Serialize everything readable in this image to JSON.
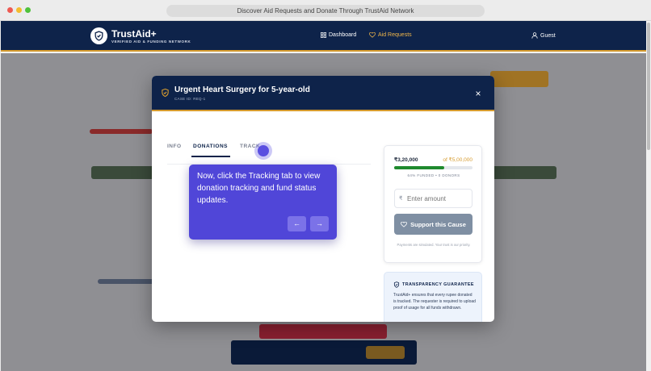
{
  "browser": {
    "url_title": "Discover Aid Requests and Donate Through TrustAid Network"
  },
  "navbar": {
    "brand": "TrustAid+",
    "tagline": "VERIFIED AID & FUNDING NETWORK",
    "items": [
      {
        "label": "Dashboard",
        "icon": "grid-icon",
        "active": false
      },
      {
        "label": "Aid Requests",
        "icon": "heart-icon",
        "active": true
      }
    ],
    "user": {
      "label": "Guest",
      "icon": "user-icon"
    }
  },
  "modal": {
    "title": "Urgent Heart Surgery for 5-year-old",
    "case_id": "CASE ID: REQ-1",
    "close": "×",
    "tabs": [
      "INFO",
      "DONATIONS",
      "TRACK"
    ],
    "active_tab": "DONATIONS",
    "donation": {
      "raised": "₹3,20,000",
      "goal": "of ₹5,00,000",
      "progress_fraction": 0.64,
      "stats": "64% FUNDED • 0 DONORS",
      "amount_placeholder": "Enter amount",
      "currency_symbol": "₹",
      "button": "Support this Cause",
      "note": "Payments are simulated. Your trust is our priority."
    },
    "guarantee": {
      "title": "TRANSPARENCY GUARANTEE",
      "text": "TrustAid+ ensures that every rupee donated is tracked. The requester is required to upload proof of usage for all funds withdrawn."
    }
  },
  "tour": {
    "text": "Now, click the Tracking tab to view donation tracking and fund status updates.",
    "prev": "←",
    "next": "→"
  },
  "colors": {
    "navy": "#0e234a",
    "gold": "#d69b2e",
    "progress": "#1f8a2e",
    "tour": "#5046d8"
  }
}
